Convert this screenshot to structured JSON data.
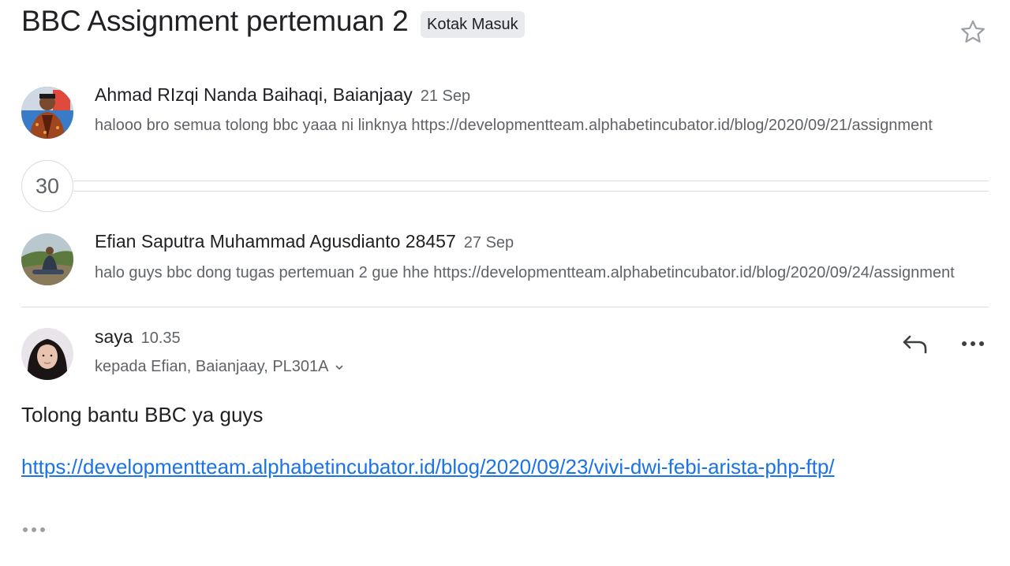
{
  "thread": {
    "subject": "BBC Assignment pertemuan 2",
    "label": "Kotak Masuk",
    "collapsed_count": "30"
  },
  "messages": [
    {
      "sender": "Ahmad RIzqi Nanda Baihaqi, Baianjaay",
      "date": "21 Sep",
      "snippet": "halooo bro semua tolong bbc yaaa ni linknya https://developmentteam.alphabetincubator.id/blog/2020/09/21/assignment"
    },
    {
      "sender": "Efian Saputra Muhammad Agusdianto 28457",
      "date": "27 Sep",
      "snippet": "halo guys bbc dong tugas pertemuan 2 gue hhe https://developmentteam.alphabetincubator.id/blog/2020/09/24/assignment"
    }
  ],
  "open_message": {
    "sender": "saya",
    "time": "10.35",
    "recipients": "kepada Efian, Baianjaay, PL301A",
    "body": "Tolong bantu BBC ya guys",
    "link": "https://developmentteam.alphabetincubator.id/blog/2020/09/23/vivi-dwi-febi-arista-php-ftp/"
  },
  "icons": {
    "star": "star-outline-icon",
    "reply": "reply-icon",
    "more": "more-horizontal-icon",
    "expand": "chevron-down-icon",
    "trimmed": "ellipsis-icon"
  },
  "colors": {
    "link": "#1a73e8",
    "secondary_text": "#5f6368",
    "chip_bg": "#e8eaed",
    "divider": "#dadce0"
  }
}
